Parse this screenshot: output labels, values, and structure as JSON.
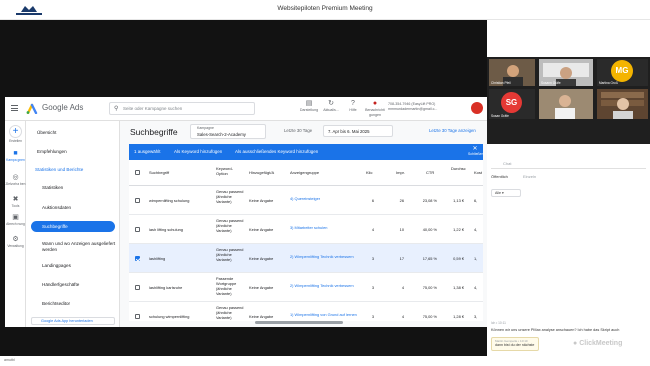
{
  "meeting": {
    "title": "Websitepiloten Premium Meeting"
  },
  "google_ads": {
    "product_name": "Google Ads",
    "search_placeholder": "Seite oder Kampagne suchen",
    "tools": [
      {
        "icon": "bar-chart-icon",
        "label": "Darstellung"
      },
      {
        "icon": "refresh-icon",
        "label": "Aktualis..."
      },
      {
        "icon": "help-icon",
        "label": "Hilfe"
      },
      {
        "icon": "bell-icon",
        "label": "Benachrichti gungen"
      }
    ],
    "account_id": "708-354-7946 (EasyLift PRO)",
    "account_email": "mmmurdadermartin@gmail.c...",
    "rail": [
      {
        "icon": "plus-icon",
        "label": "Erstellen"
      },
      {
        "icon": "campaign-icon",
        "label": "Kampa gnen"
      },
      {
        "icon": "target-icon",
        "label": "Zielvorha ben"
      },
      {
        "icon": "tools-icon",
        "label": "Tools"
      },
      {
        "icon": "billing-icon",
        "label": "Abrech nung"
      },
      {
        "icon": "admin-icon",
        "label": "Verwaltung"
      }
    ],
    "nav": {
      "overview": "Übersicht",
      "recommendations": "Empfehlungen",
      "section": "Statistiken und Berichte",
      "items": [
        "Statistiken",
        "Auktionsdaten",
        "Suchbegriffe",
        "Wann und wo Anzeigen ausgeliefert werden",
        "Landingpages",
        "Händlerfgeschäfte",
        "Berichtseditor"
      ],
      "app_button": "Google Ads App herunterladen"
    },
    "page_title": "Suchbegriffe",
    "campaign_label": "Kampagne",
    "campaign_value": "Sales-Search-2-Academy",
    "date_label": "Letzte 30 Tage",
    "date_range": "7. Apr bis 6. Mai 2025",
    "last_days_link": "Letzte 30 Tage anzeigen",
    "selection_bar": {
      "selected": "1 ausgewählt",
      "action_keyword": "Als Keyword hinzufügen",
      "action_negative": "Als ausschließendes Keyword hinzufügen",
      "close": "Schließen"
    },
    "columns": [
      "Suchbegriff",
      "Keyword-Option",
      "Hinzugefügt/A",
      "Anzeigengruppe",
      "Klic",
      "Impr.",
      "CTR",
      "Durchsc",
      "Kost"
    ],
    "rows": [
      {
        "term": "wimpernlifting schulung",
        "match": "Genau passend (ähnliche Variante)",
        "added": "Keine Angabe",
        "group": "4) Quereinsteiger",
        "clicks": "6",
        "impr": "26",
        "ctr": "23,08 %",
        "cpc": "1,13 €",
        "cost": "6,",
        "checked": false
      },
      {
        "term": "lash lifting schulung",
        "match": "Genau passend (ähnliche Variante)",
        "added": "Keine Angabe",
        "group": "3) Mitarbeiter schulen",
        "clicks": "4",
        "impr": "10",
        "ctr": "40,00 %",
        "cpc": "1,22 €",
        "cost": "4,",
        "checked": false
      },
      {
        "term": "lashlifting",
        "match": "Genau passend (ähnliche Variante)",
        "added": "Keine Angabe",
        "group": "2) Wimpernlifting Technik verbessern",
        "clicks": "3",
        "impr": "17",
        "ctr": "17,65 %",
        "cpc": "0,59 €",
        "cost": "1,",
        "checked": true
      },
      {
        "term": "lashlifting karlsruhe",
        "match": "Passende Wortgruppe (ähnliche Variante)",
        "added": "Keine Angabe",
        "group": "2) Wimpernlifting Technik verbessern",
        "clicks": "3",
        "impr": "4",
        "ctr": "75,00 %",
        "cpc": "1,38 €",
        "cost": "4,",
        "checked": false
      },
      {
        "term": "schulung wimpernlifting",
        "match": "Genau passend (ähnliche Variante)",
        "added": "Keine Angabe",
        "group": "1) Wimpernlifting von Grund auf lernen",
        "clicks": "3",
        "impr": "4",
        "ctr": "75,00 %",
        "cpc": "1,28 €",
        "cost": "3,",
        "checked": false
      }
    ]
  },
  "participants": [
    {
      "name": "Christian Pfeil",
      "initials": ""
    },
    {
      "name": "Susann Gräfe",
      "initials": ""
    },
    {
      "name": "Martina Groß",
      "initials": "MG",
      "color": "#f4b400"
    },
    {
      "name": "Susan Gräfe",
      "initials": "SG",
      "color": "#e53935"
    },
    {
      "name": "",
      "initials": ""
    },
    {
      "name": "",
      "initials": ""
    }
  ],
  "chat": {
    "input_placeholder": "Chat",
    "tab_public": "Öffentlich",
    "tab_private": "Einzeln",
    "filter_label": "Alle",
    "msg_meta": "Ich • 10:11",
    "msg_text": "Können wir uns unsere PMax analyse anschauen? Ich habe das Skript auch",
    "reply_meta": "Martin Gemperle • 10:10",
    "reply_text": "dann bist du der nächste",
    "brand": "ClickMeeting"
  },
  "footer": {
    "status": "amutbl"
  },
  "colors": {
    "accent": "#1a73e8",
    "notif": "#d93025",
    "stage": "#121212"
  }
}
